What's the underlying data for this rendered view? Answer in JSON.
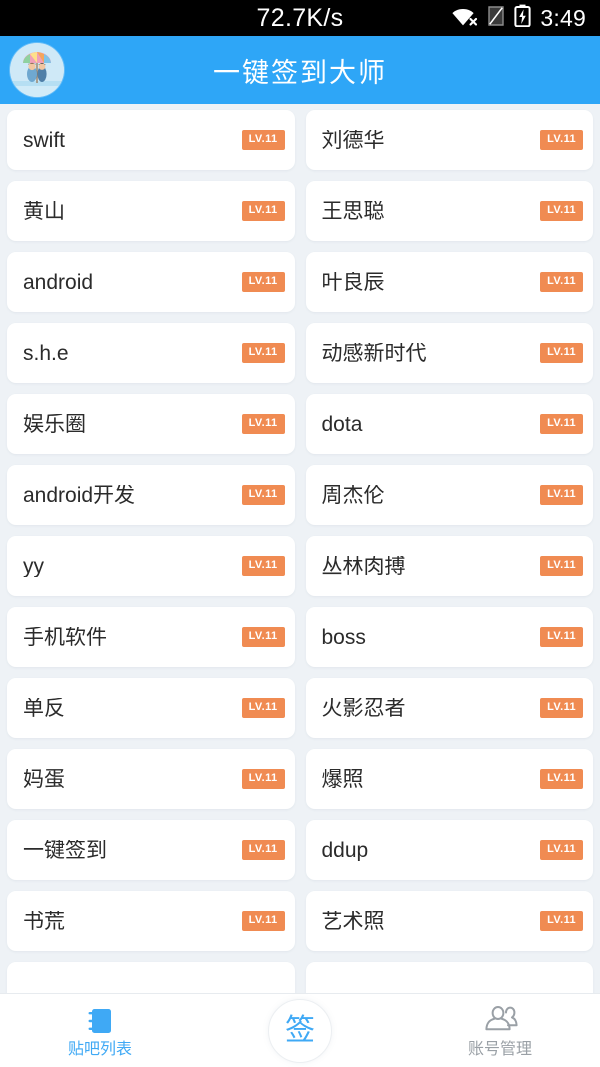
{
  "status_bar": {
    "network_speed": "72.7K/s",
    "clock": "3:49",
    "icons": [
      "wifi-disconnected-icon",
      "signal-none-icon",
      "battery-charging-icon"
    ]
  },
  "header": {
    "title": "一键签到大师",
    "avatar_name": "user-avatar",
    "background_color": "#2EA6F7"
  },
  "list": {
    "badge_color": "#F08B52",
    "items": [
      {
        "name": "swift",
        "level": "LV.11"
      },
      {
        "name": "刘德华",
        "level": "LV.11"
      },
      {
        "name": "黄山",
        "level": "LV.11"
      },
      {
        "name": "王思聪",
        "level": "LV.11"
      },
      {
        "name": "android",
        "level": "LV.11"
      },
      {
        "name": "叶良辰",
        "level": "LV.11"
      },
      {
        "name": "s.h.e",
        "level": "LV.11"
      },
      {
        "name": "动感新时代",
        "level": "LV.11"
      },
      {
        "name": "娱乐圈",
        "level": "LV.11"
      },
      {
        "name": "dota",
        "level": "LV.11"
      },
      {
        "name": "android开发",
        "level": "LV.11"
      },
      {
        "name": "周杰伦",
        "level": "LV.11"
      },
      {
        "name": "yy",
        "level": "LV.11"
      },
      {
        "name": "丛林肉搏",
        "level": "LV.11"
      },
      {
        "name": "手机软件",
        "level": "LV.11"
      },
      {
        "name": "boss",
        "level": "LV.11"
      },
      {
        "name": "单反",
        "level": "LV.11"
      },
      {
        "name": "火影忍者",
        "level": "LV.11"
      },
      {
        "name": "妈蛋",
        "level": "LV.11"
      },
      {
        "name": "爆照",
        "level": "LV.11"
      },
      {
        "name": "一键签到",
        "level": "LV.11"
      },
      {
        "name": "ddup",
        "level": "LV.11"
      },
      {
        "name": "书荒",
        "level": "LV.11"
      },
      {
        "name": "艺术照",
        "level": "LV.11"
      },
      {
        "name": "",
        "level": ""
      },
      {
        "name": "",
        "level": ""
      }
    ]
  },
  "bottom_nav": {
    "active_color": "#3FA9F5",
    "inactive_color": "#9aa0a6",
    "left": {
      "label": "贴吧列表",
      "icon": "notebook-icon",
      "active": true
    },
    "center": {
      "label": "签",
      "icon": "sign-in-circle-button"
    },
    "right": {
      "label": "账号管理",
      "icon": "users-icon",
      "active": false
    }
  }
}
